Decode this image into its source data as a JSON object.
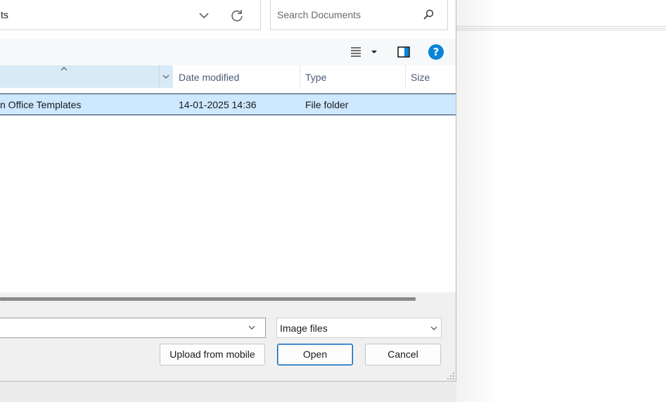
{
  "address_bar": {
    "path_text": "ts"
  },
  "search": {
    "placeholder": "Search Documents"
  },
  "toolbar": {
    "help_label": "?"
  },
  "columns": {
    "date_modified": "Date modified",
    "type": "Type",
    "size": "Size"
  },
  "files": [
    {
      "name": "n Office Templates",
      "date_modified": "14-01-2025 14:36",
      "type": "File folder",
      "size": ""
    }
  ],
  "bottom": {
    "filename_value": "",
    "filetype_selected": "Image files",
    "upload_label": "Upload from mobile",
    "open_label": "Open",
    "cancel_label": "Cancel"
  },
  "colors": {
    "accent": "#005fb8",
    "selection": "#cde8ff",
    "help_blue": "#0a84d6"
  },
  "icons": [
    "chevron-down-icon",
    "refresh-icon",
    "search-icon",
    "view-menu-icon",
    "dropdown-icon",
    "preview-pane-icon",
    "help-icon",
    "sort-caret-icon",
    "resize-grip-icon"
  ]
}
